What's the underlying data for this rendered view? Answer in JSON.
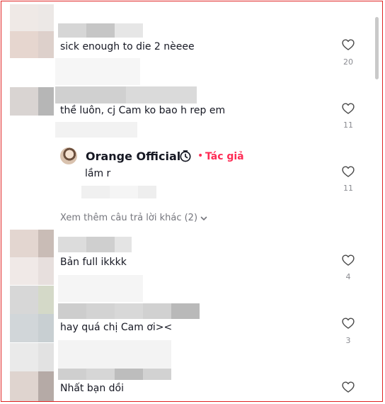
{
  "comments": [
    {
      "text": "sick enough to die 2 nèeee",
      "likes": "20"
    },
    {
      "text": "thề luôn, cj Cam ko bao h rep em",
      "likes": "11"
    },
    {
      "text": "Bản full ikkkk",
      "likes": "4"
    },
    {
      "text": "hay quá chị Cam ơi><",
      "likes": "3"
    },
    {
      "text": "Nhất bạn dồi",
      "likes": ""
    }
  ],
  "reply": {
    "author_name": "Orange Official",
    "author_tag": "Tác giả",
    "text": "lầm r",
    "likes": "11"
  },
  "view_more": {
    "label": "Xem thêm câu trả lời khác (2)"
  },
  "icons": {
    "like": "heart-outline-icon",
    "badge": "clock-badge-icon",
    "expand": "chevron-down-icon"
  },
  "colors": {
    "accent": "#fe2c55",
    "text": "#161823",
    "muted": "#8a8b91",
    "border": "#e02424"
  }
}
